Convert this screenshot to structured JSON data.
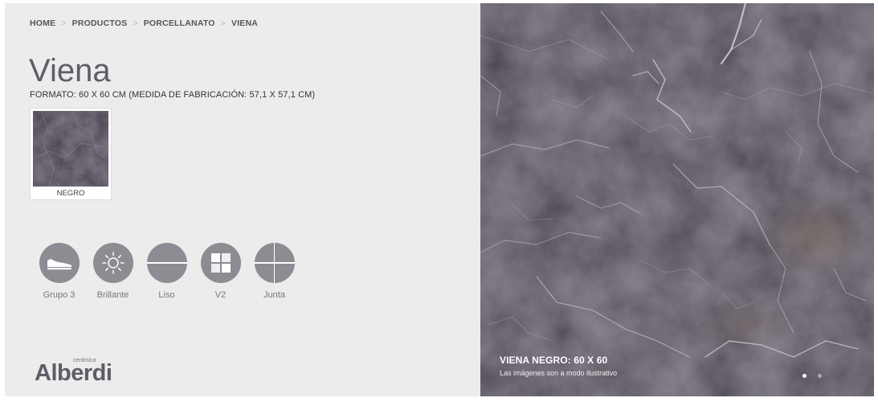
{
  "breadcrumb": {
    "items": [
      "HOME",
      "PRODUCTOS",
      "PORCELLANATO",
      "VIENA"
    ],
    "separator": ">"
  },
  "product": {
    "title": "Viena",
    "format": "FORMATO: 60 X 60 CM (MEDIDA DE FABRICACIÓN: 57,1 X 57,1 CM)"
  },
  "swatches": [
    {
      "label": "NEGRO",
      "color": "#3e3843"
    }
  ],
  "features": [
    {
      "label": "Grupo 3",
      "icon": "shoe-icon"
    },
    {
      "label": "Brillante",
      "icon": "sun-icon"
    },
    {
      "label": "Liso",
      "icon": "flat-surface-icon"
    },
    {
      "label": "V2",
      "icon": "tile-variation-icon"
    },
    {
      "label": "Junta",
      "icon": "joint-icon"
    }
  ],
  "logo": {
    "small": "cerámica",
    "main": "Alberdi"
  },
  "hero": {
    "caption_title": "VIENA NEGRO: 60 X 60",
    "caption_note": "Las imágenes son a modo ilustrativo",
    "slides": 2,
    "active_slide": 1
  },
  "colors": {
    "panel_bg": "#ececec",
    "icon_bg": "#8c8c93",
    "title": "#5d5d66",
    "marble_base": "#3b3640"
  }
}
